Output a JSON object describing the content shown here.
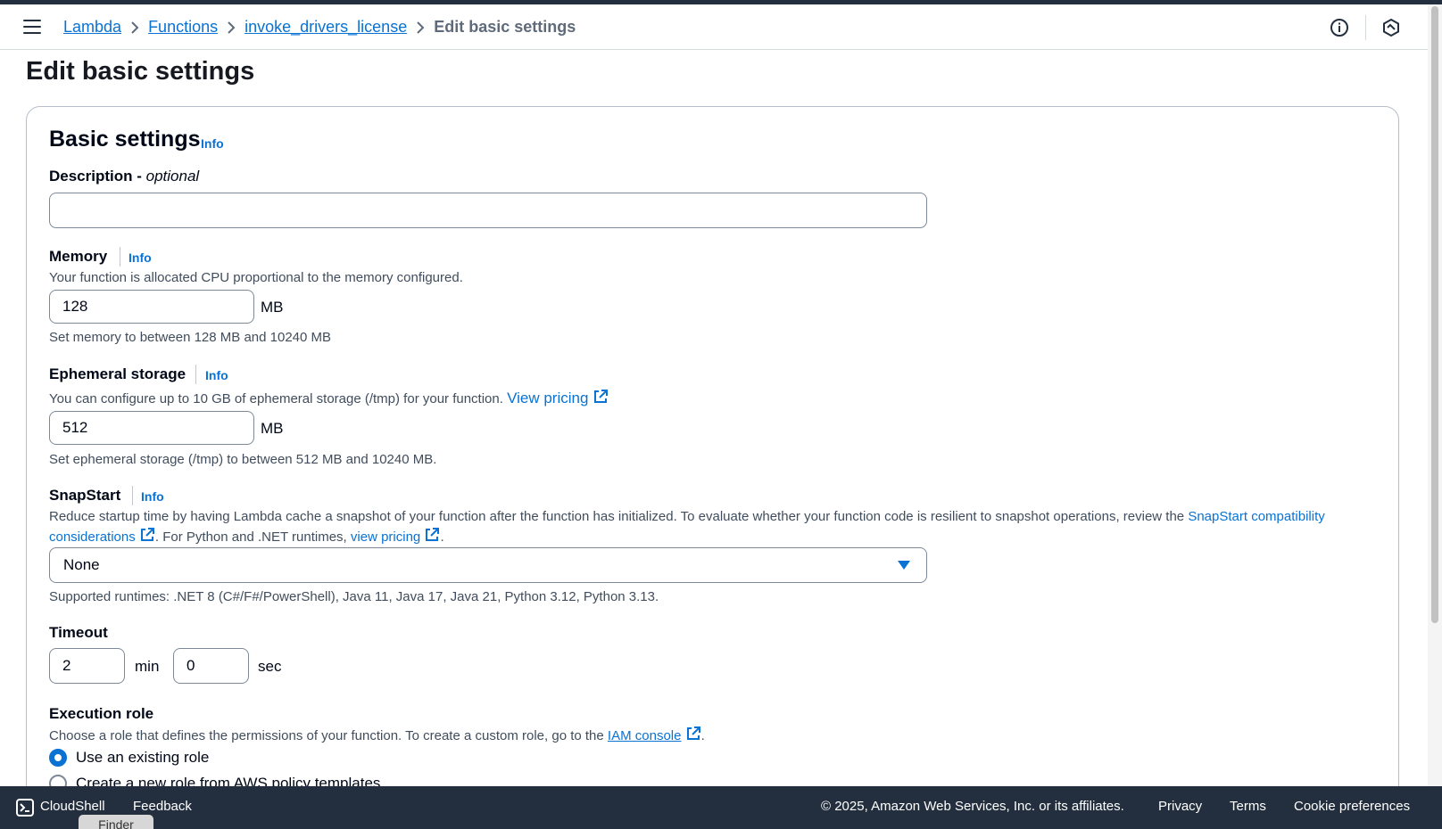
{
  "breadcrumb": {
    "items": [
      "Lambda",
      "Functions",
      "invoke_drivers_license"
    ],
    "current": "Edit basic settings"
  },
  "page_title": "Edit basic settings",
  "basic_settings": {
    "heading": "Basic settings",
    "info": "Info"
  },
  "description_field": {
    "label": "Description - ",
    "label_optional": "optional",
    "value": "",
    "placeholder": ""
  },
  "memory": {
    "label": "Memory",
    "info": "Info",
    "help": "Your function is allocated CPU proportional to the memory configured.",
    "value": "128",
    "unit": "MB",
    "constraint": "Set memory to between 128 MB and 10240 MB"
  },
  "ephemeral_storage": {
    "label": "Ephemeral storage",
    "info": "Info",
    "help": "You can configure up to 10 GB of ephemeral storage (/tmp) for your function.",
    "pricing_link": "View pricing",
    "value": "512",
    "unit": "MB",
    "constraint": "Set ephemeral storage (/tmp) to between 512 MB and 10240 MB."
  },
  "snapstart": {
    "label": "SnapStart",
    "info": "Info",
    "help_line1": "Reduce startup time by having Lambda cache a snapshot of your function after the function has initialized. To evaluate whether your function code is resilient to snapshot operations, review the",
    "compat_link_1": "SnapStart compatibility",
    "compat_link_2": "considerations",
    "help_mid": ". For Python and .NET runtimes,",
    "pricing_link": "view pricing",
    "help_end": ".",
    "selected": "None",
    "supported": "Supported runtimes: .NET 8 (C#/F#/PowerShell), Java 11, Java 17, Java 21, Python 3.12, Python 3.13."
  },
  "timeout": {
    "label": "Timeout",
    "min_value": "2",
    "min_unit": "min",
    "sec_value": "0",
    "sec_unit": "sec"
  },
  "execution_role": {
    "label": "Execution role",
    "help": "Choose a role that defines the permissions of your function. To create a custom role, go to the",
    "iam_link": "IAM console",
    "help_end": ".",
    "options": [
      "Use an existing role",
      "Create a new role from AWS policy templates"
    ],
    "selected_index": 0
  },
  "footer": {
    "cloudshell": "CloudShell",
    "feedback": "Feedback",
    "copyright": "© 2025, Amazon Web Services, Inc. or its affiliates.",
    "privacy": "Privacy",
    "terms": "Terms",
    "cookies": "Cookie preferences"
  },
  "dock_tooltip": "Finder",
  "colors": {
    "link": "#0972d3",
    "header_dark": "#232f3e",
    "border": "#7d8998",
    "text": "#000716",
    "secondary_text": "#414d5c"
  },
  "icons": [
    "menu-icon",
    "chevron-right-icon",
    "info-circle-icon",
    "notifications-hex-icon",
    "external-link-icon",
    "caret-down-icon",
    "cloudshell-terminal-icon"
  ]
}
